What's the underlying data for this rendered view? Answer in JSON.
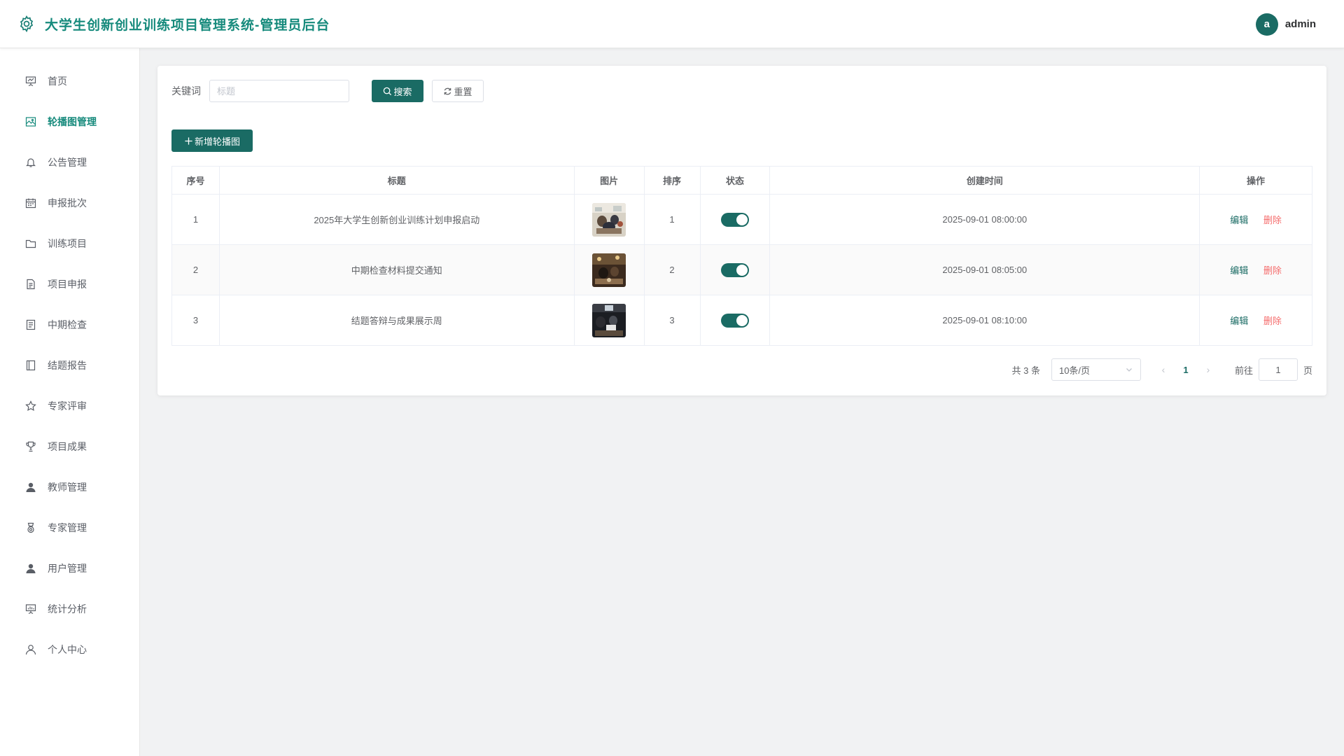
{
  "header": {
    "title": "大学生创新创业训练项目管理系统-管理员后台",
    "avatar_letter": "a",
    "username": "admin"
  },
  "sidebar": {
    "items": [
      {
        "label": "首页",
        "icon": "presentation-icon"
      },
      {
        "label": "轮播图管理",
        "icon": "image-icon",
        "active": true
      },
      {
        "label": "公告管理",
        "icon": "bell-icon"
      },
      {
        "label": "申报批次",
        "icon": "calendar-icon"
      },
      {
        "label": "训练项目",
        "icon": "folder-icon"
      },
      {
        "label": "项目申报",
        "icon": "document-icon"
      },
      {
        "label": "中期检查",
        "icon": "checklist-icon"
      },
      {
        "label": "结题报告",
        "icon": "notebook-icon"
      },
      {
        "label": "专家评审",
        "icon": "star-icon"
      },
      {
        "label": "项目成果",
        "icon": "trophy-icon"
      },
      {
        "label": "教师管理",
        "icon": "user-filled-icon"
      },
      {
        "label": "专家管理",
        "icon": "medal-icon"
      },
      {
        "label": "用户管理",
        "icon": "user-filled-icon"
      },
      {
        "label": "统计分析",
        "icon": "chart-board-icon"
      },
      {
        "label": "个人中心",
        "icon": "user-outline-icon"
      }
    ]
  },
  "search": {
    "keyword_label": "关键词",
    "placeholder": "标题",
    "value": "",
    "search_label": "搜索",
    "reset_label": "重置"
  },
  "toolbar": {
    "add_label": "新增轮播图"
  },
  "table": {
    "columns": [
      "序号",
      "标题",
      "图片",
      "排序",
      "状态",
      "创建时间",
      "操作"
    ],
    "rows": [
      {
        "index": "1",
        "title": "2025年大学生创新创业训练计划申报启动",
        "sort": "1",
        "enabled": true,
        "created": "2025-09-01 08:00:00"
      },
      {
        "index": "2",
        "title": "中期检查材料提交通知",
        "sort": "2",
        "enabled": true,
        "created": "2025-09-01 08:05:00"
      },
      {
        "index": "3",
        "title": "结题答辩与成果展示周",
        "sort": "3",
        "enabled": true,
        "created": "2025-09-01 08:10:00"
      }
    ],
    "edit_label": "编辑",
    "delete_label": "删除"
  },
  "pagination": {
    "total_text": "共 3 条",
    "page_size": "10条/页",
    "current_page": "1",
    "goto_label": "前往",
    "goto_value": "1",
    "goto_suffix": "页"
  },
  "colors": {
    "primary": "#1a6b64",
    "title": "#168a7c",
    "danger": "#f56c6c"
  }
}
